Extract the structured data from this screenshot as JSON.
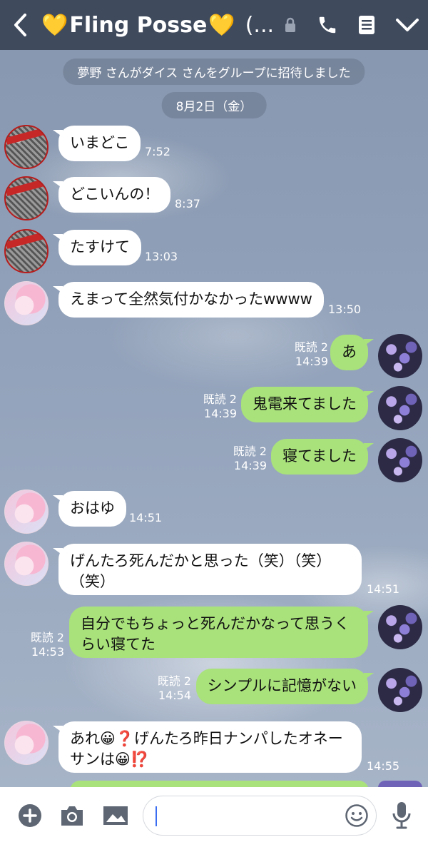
{
  "header": {
    "title": "Fling Posse",
    "title_suffix": "(...",
    "heart": "💛"
  },
  "system_notice": "夢野 さんがダイス さんをグループに招待しました",
  "date_divider": "8月2日（金）",
  "messages": [
    {
      "side": "in",
      "avatar": "red",
      "text": "いまどこ",
      "time": "7:52"
    },
    {
      "side": "in",
      "avatar": "red",
      "text": "どこいんの！",
      "time": "8:37"
    },
    {
      "side": "in",
      "avatar": "red",
      "text": "たすけて",
      "time": "13:03"
    },
    {
      "side": "in",
      "avatar": "anime",
      "text": "えまって全然気付かなかったwwww",
      "time": "13:50"
    },
    {
      "side": "out",
      "text": "あ",
      "read": "既読 2",
      "time": "14:39"
    },
    {
      "side": "out",
      "text": "鬼電来てました",
      "read": "既読 2",
      "time": "14:39"
    },
    {
      "side": "out",
      "text": "寝てました",
      "read": "既読 2",
      "time": "14:39"
    },
    {
      "side": "in",
      "avatar": "anime",
      "text": "おはゆ",
      "time": "14:51"
    },
    {
      "side": "in",
      "avatar": "anime",
      "text_line1": "げんたろ死んだかと思った（笑）（笑）",
      "text_line2": "（笑）",
      "time": "14:51"
    },
    {
      "side": "out",
      "text_line1": "自分でもちょっと死んだかなって思うく",
      "text_line2": "らい寝てた",
      "read": "既読 2",
      "time": "14:53"
    },
    {
      "side": "out",
      "text": "シンプルに記憶がない",
      "read": "既読 2",
      "time": "14:54"
    },
    {
      "side": "in",
      "avatar": "anime",
      "text_line1": "あれ😀❓げんたろ昨日ナンパしたオネー",
      "text_line2": "サンは😀⁉️",
      "time": "14:55"
    }
  ],
  "input": {
    "placeholder": ""
  },
  "colors": {
    "header": "#3f4a5d",
    "bubble_out": "#a9e27b",
    "bubble_in": "#ffffff",
    "heart": "#f5c518"
  }
}
